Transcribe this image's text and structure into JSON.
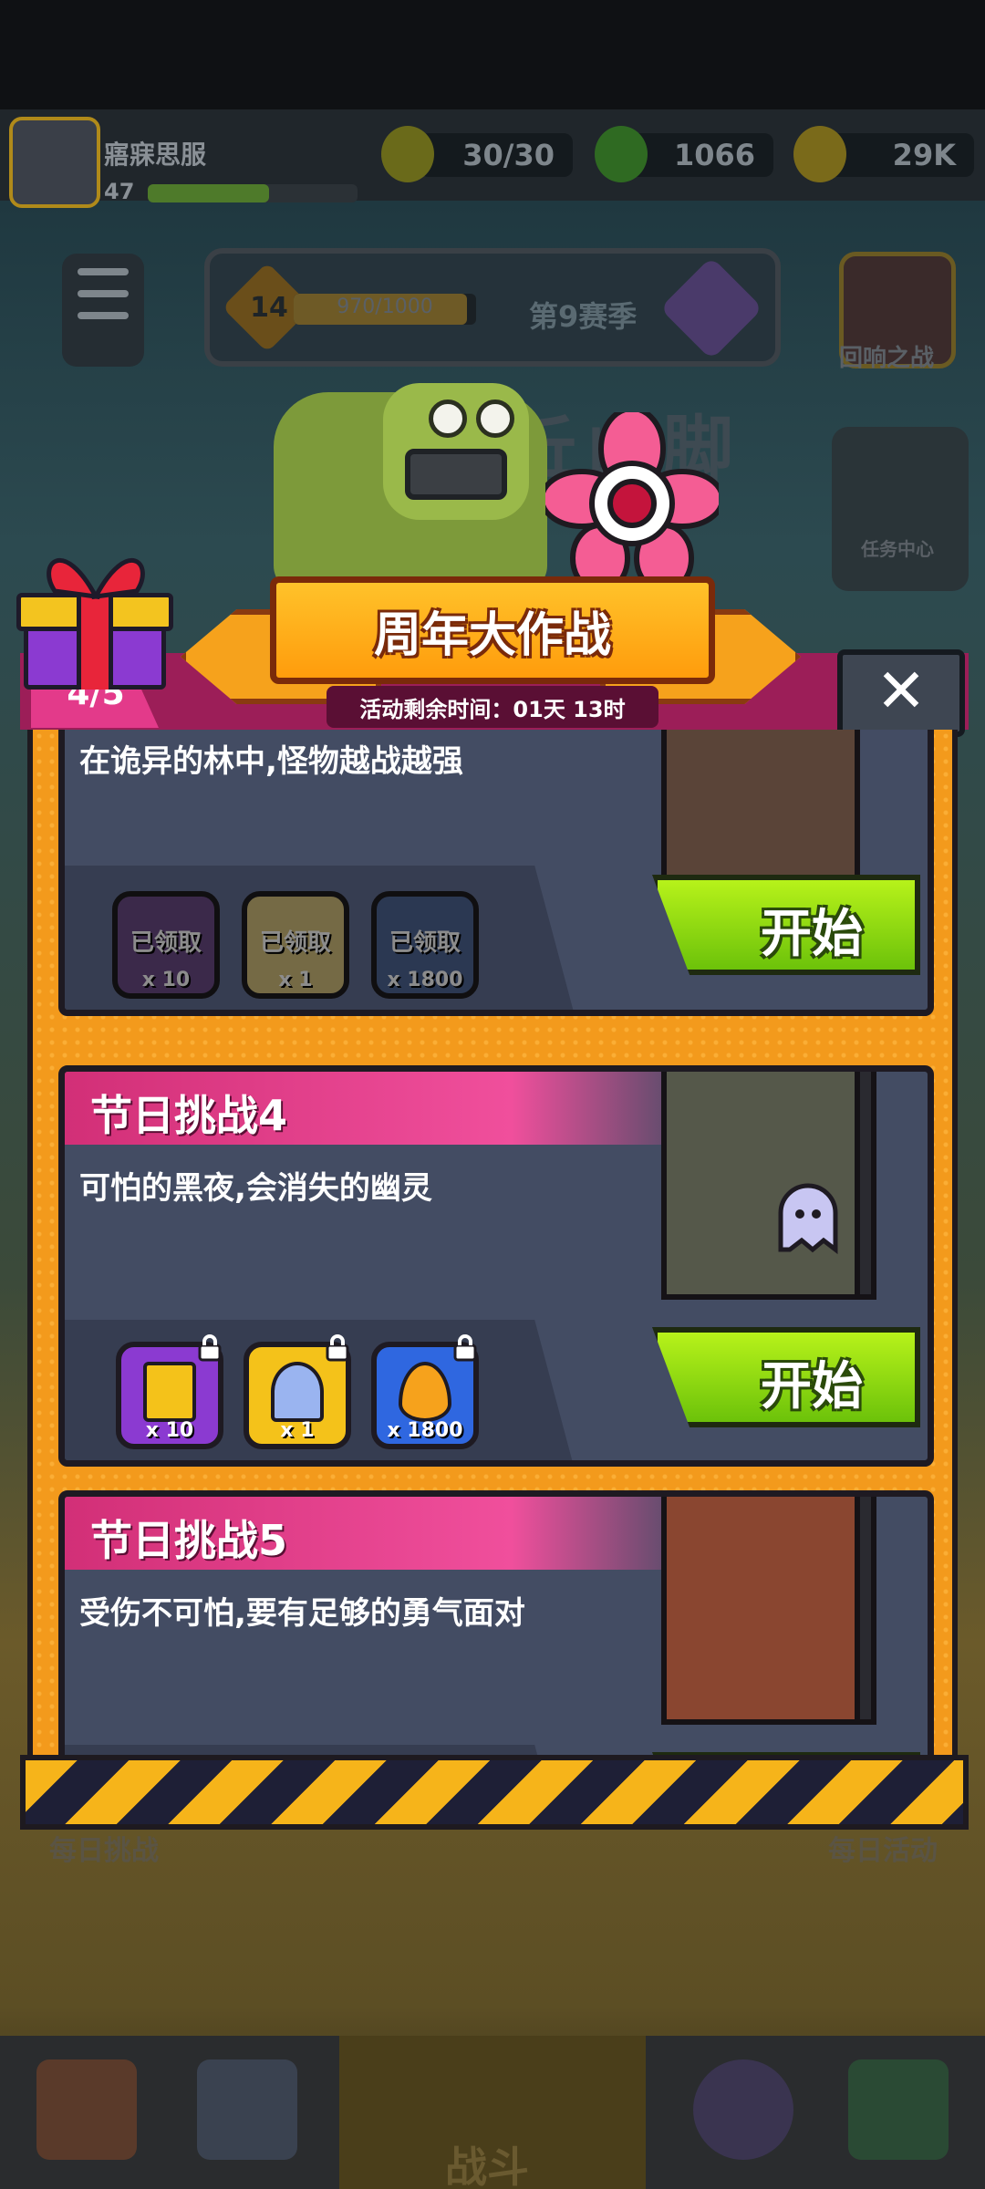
{
  "background": {
    "player_name": "寤寐思服",
    "player_level": "47",
    "resources": [
      {
        "icon": "lightning-icon",
        "value": "30/30"
      },
      {
        "icon": "green-gem-icon",
        "value": "1066"
      },
      {
        "icon": "gold-coin-icon",
        "value": "29K"
      }
    ],
    "season": {
      "level": "14",
      "xp_text": "970/1000",
      "name": "第9赛季"
    },
    "echo_battle": "回响之战",
    "task_center": "任务中心",
    "stage_title": "25 .. 丘山脚",
    "side_left": "每日挑战",
    "side_right": "每日活动",
    "battle_tab": "战斗"
  },
  "event": {
    "title": "周年大作战",
    "progress": "4/5",
    "timer": "活动剩余时间：01天 13时",
    "close_label": "✕"
  },
  "challenges": [
    {
      "title": "",
      "desc": "在诡异的林中,怪物越战越强",
      "start_label": "开始",
      "rewards": [
        {
          "icon": "potion-icon",
          "count": "x 10",
          "status": "已领取"
        },
        {
          "icon": "key-icon",
          "count": "x 1",
          "status": "已领取"
        },
        {
          "icon": "flame-drop-icon",
          "count": "x 1800",
          "status": "已领取"
        }
      ]
    },
    {
      "title": "节日挑战4",
      "desc": "可怕的黑夜,会消失的幽灵",
      "start_label": "开始",
      "rewards": [
        {
          "icon": "potion-icon",
          "count": "x 10",
          "status": ""
        },
        {
          "icon": "key-icon",
          "count": "x 1",
          "status": ""
        },
        {
          "icon": "flame-drop-icon",
          "count": "x 1800",
          "status": ""
        }
      ]
    },
    {
      "title": "节日挑战5",
      "desc": "受伤不可怕,要有足够的勇气面对",
      "start_label": "开始",
      "rewards": []
    }
  ],
  "colors": {
    "accent_pink": "#e33a8a",
    "start_green": "#8fdc12",
    "panel_orange": "#f39a1c"
  }
}
